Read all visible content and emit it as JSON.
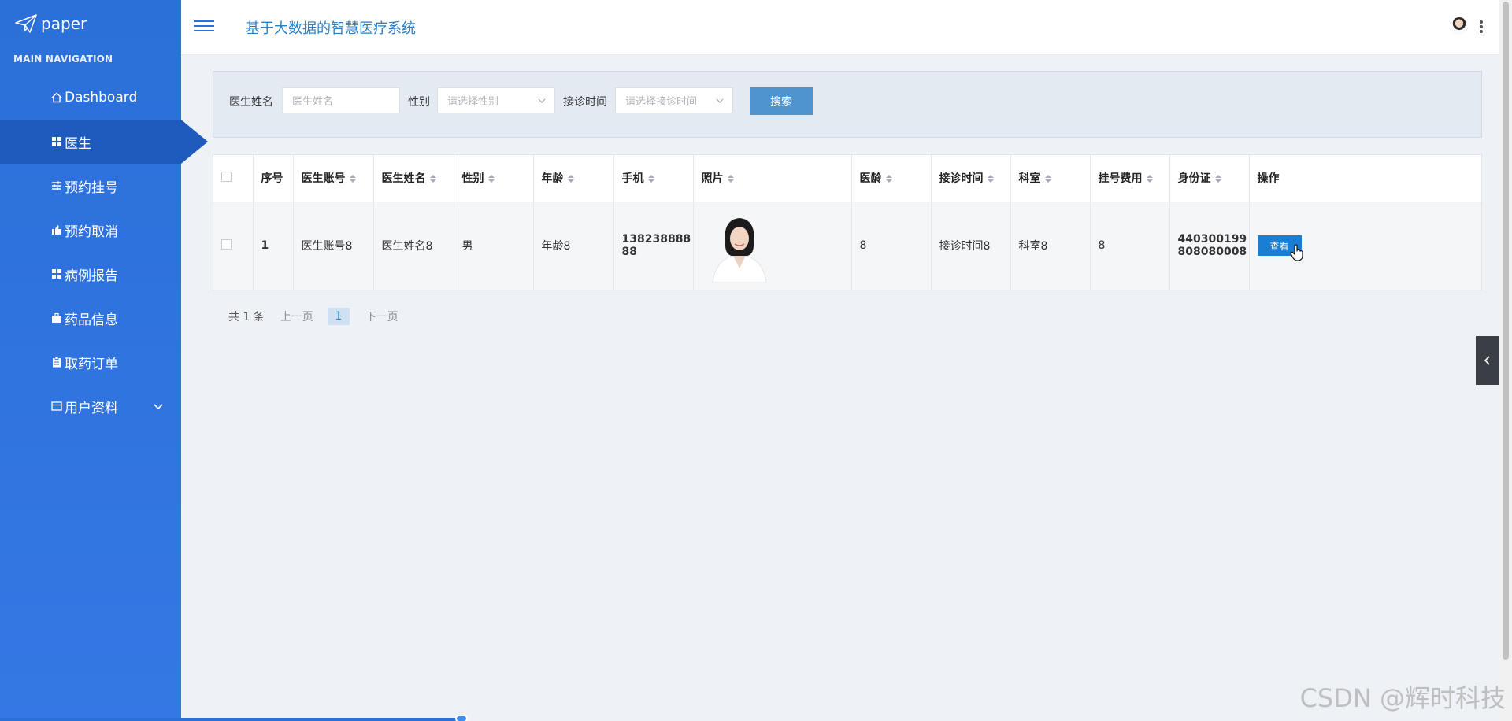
{
  "logo": {
    "text": "paper"
  },
  "sidebar": {
    "heading": "MAIN NAVIGATION",
    "items": [
      {
        "label": "Dashboard",
        "icon": "home-icon"
      },
      {
        "label": "医生",
        "icon": "grid-icon",
        "active": true
      },
      {
        "label": "预约挂号",
        "icon": "sliders-icon"
      },
      {
        "label": "预约取消",
        "icon": "thumbs-icon"
      },
      {
        "label": "病例报告",
        "icon": "grid-icon"
      },
      {
        "label": "药品信息",
        "icon": "briefcase-icon"
      },
      {
        "label": "取药订单",
        "icon": "clipboard-icon"
      },
      {
        "label": "用户资料",
        "icon": "card-icon",
        "expandable": true
      }
    ]
  },
  "header": {
    "title": "基于大数据的智慧医疗系统"
  },
  "search": {
    "name_label": "医生姓名",
    "name_placeholder": "医生姓名",
    "gender_label": "性别",
    "gender_placeholder": "请选择性别",
    "time_label": "接诊时间",
    "time_placeholder": "请选择接诊时间",
    "button": "搜索"
  },
  "table": {
    "headers": [
      "序号",
      "医生账号",
      "医生姓名",
      "性别",
      "年龄",
      "手机",
      "照片",
      "医龄",
      "接诊时间",
      "科室",
      "挂号费用",
      "身份证",
      "操作"
    ],
    "rows": [
      {
        "index": "1",
        "account": "医生账号8",
        "name": "医生姓名8",
        "gender": "男",
        "age": "年龄8",
        "phone": "13823888888",
        "phone_line1": "138238888",
        "phone_line2": "88",
        "seniority": "8",
        "time": "接诊时间8",
        "dept": "科室8",
        "fee": "8",
        "id_line1": "440300199",
        "id_line2": "808080008",
        "action": "查看"
      }
    ]
  },
  "pager": {
    "total": "共 1 条",
    "prev": "上一页",
    "current": "1",
    "next": "下一页"
  },
  "watermark": "CSDN @辉时科技",
  "colors": {
    "sidebar": "#2b6fd9",
    "active": "#1f5bbd",
    "title": "#2a7fc4",
    "search_button": "#4f93cf",
    "view_button": "#1a7fd4"
  }
}
